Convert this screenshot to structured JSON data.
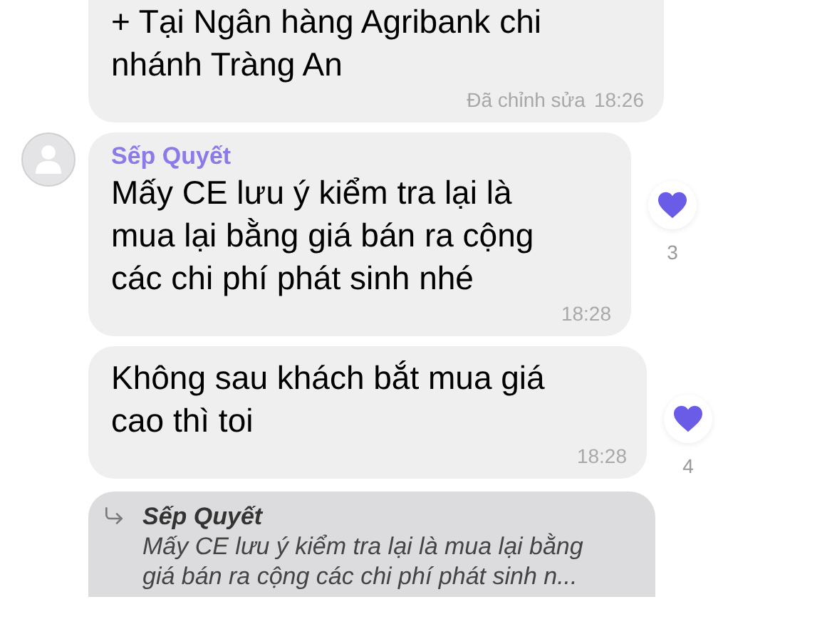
{
  "messages": [
    {
      "kind": "text",
      "lines": [
        "+ Tại Ngân hàng Agribank chi",
        "nhánh Tràng An"
      ],
      "edited": "Đã chỉnh sửa",
      "time": "18:26"
    },
    {
      "kind": "text",
      "sender": "Sếp Quyết",
      "avatar": true,
      "lines": [
        "Mấy CE lưu ý kiểm tra lại là",
        "mua lại bằng giá bán ra cộng",
        "các chi phí phát sinh nhé"
      ],
      "time": "18:28",
      "reaction": {
        "count": "3"
      }
    },
    {
      "kind": "text",
      "lines": [
        "Không sau khách bắt mua giá",
        "cao thì toi"
      ],
      "time": "18:28",
      "reaction": {
        "count": "4"
      }
    },
    {
      "kind": "reply",
      "quote": {
        "sender": "Sếp Quyết",
        "lines": [
          "Mấy CE lưu ý kiểm tra lại là mua lại bằng",
          "giá bán ra cộng các chi phí phát sinh n..."
        ]
      }
    }
  ]
}
